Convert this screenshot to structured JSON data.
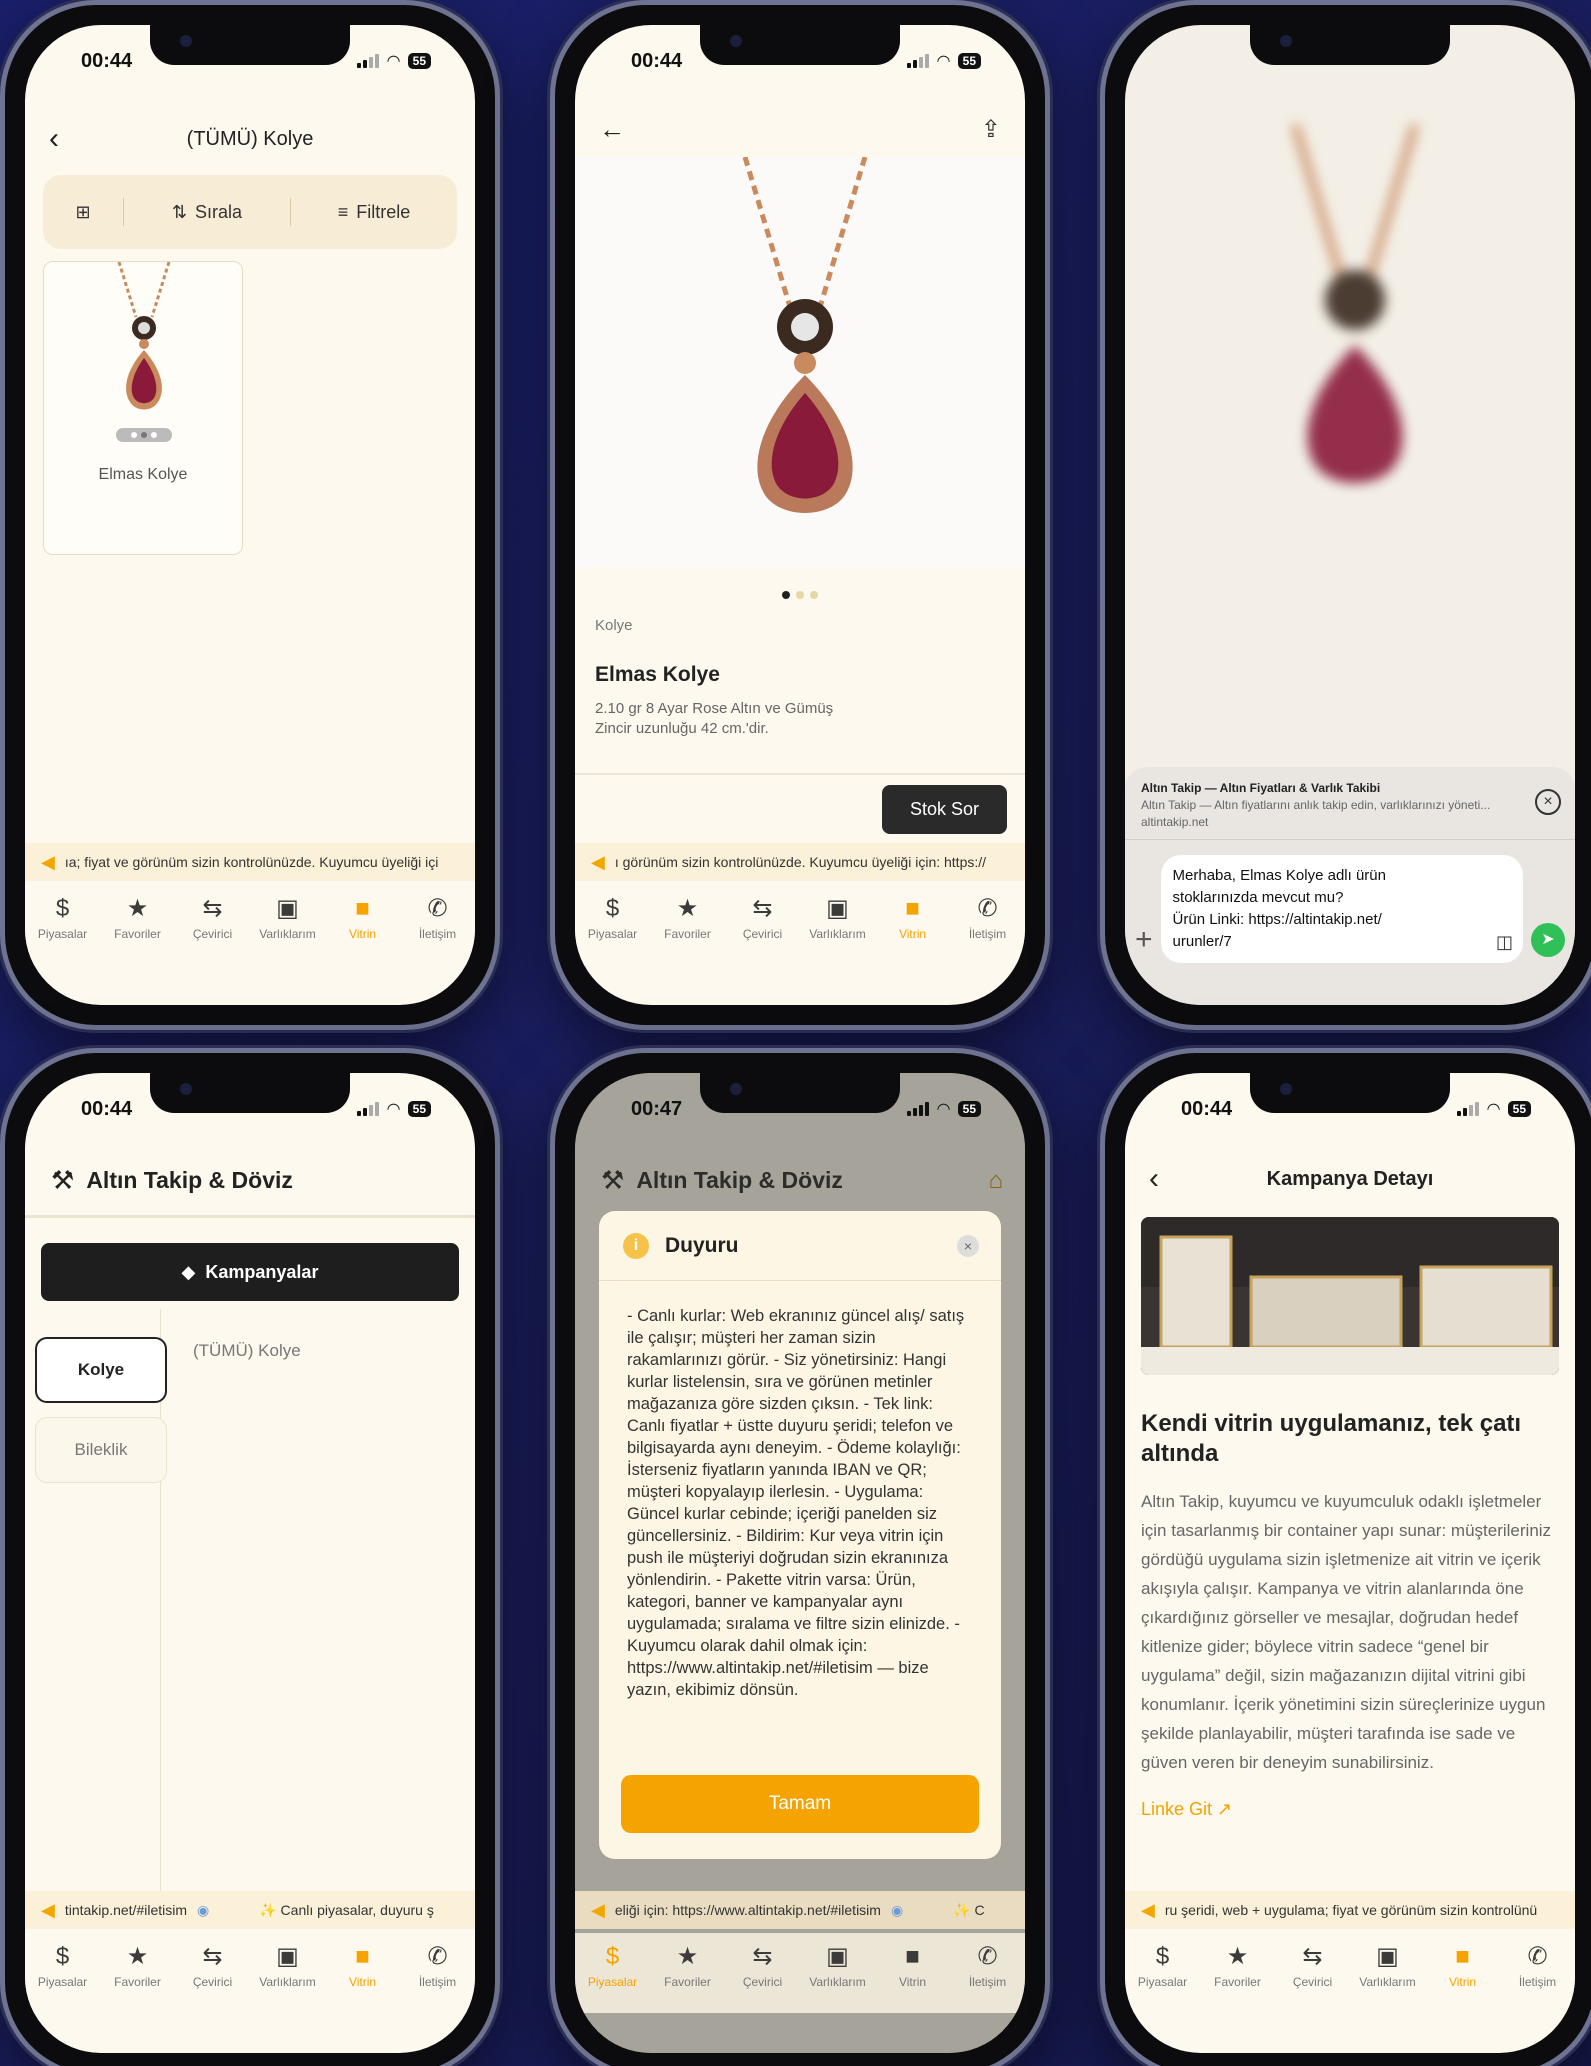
{
  "status": {
    "time_standard": "00:44",
    "time_dialog": "00:47",
    "battery": "55"
  },
  "tabs": [
    {
      "label": "Piyasalar",
      "icon": "dollar-circle-icon",
      "glyph": "$"
    },
    {
      "label": "Favoriler",
      "icon": "star-icon",
      "glyph": "★"
    },
    {
      "label": "Çevirici",
      "icon": "swap-icon",
      "glyph": "⇆"
    },
    {
      "label": "Varlıklarım",
      "icon": "box-icon",
      "glyph": "▣"
    },
    {
      "label": "Vitrin",
      "icon": "shopping-bag-icon",
      "glyph": "■"
    },
    {
      "label": "İletişim",
      "icon": "phone-icon",
      "glyph": "✆"
    }
  ],
  "phone1": {
    "title": "(TÜMÜ) Kolye",
    "sort_label": "Sırala",
    "filter_label": "Filtrele",
    "product_name": "Elmas Kolye",
    "ticker": "ıa; fiyat ve görünüm sizin kontrolünüzde. Kuyumcu üyeliği içi"
  },
  "phone2": {
    "category": "Kolye",
    "product_name": "Elmas Kolye",
    "description_line1": "2.10 gr 8 Ayar Rose Altın ve Gümüş",
    "description_line2": "Zincir uzunluğu 42 cm.'dir.",
    "stock_button": "Stok Sor",
    "ticker": "ı görünüm sizin kontrolünüzde. Kuyumcu üyeliği için: https://"
  },
  "phone3": {
    "share_title": "Altın Takip — Altın Fiyatları & Varlık Takibi",
    "share_subtitle": "Altın Takip — Altın fiyatlarını anlık takip edin, varlıklarınızı yöneti...",
    "share_url": "altintakip.net",
    "message_line1": "Merhaba, Elmas Kolye adlı ürün",
    "message_line2": "stoklarınızda mevcut mu?",
    "message_line3": "Ürün Linki: https://altintakip.net/",
    "message_line4": "urunler/7"
  },
  "phone4": {
    "app_title": "Altın Takip & Döviz",
    "campaigns_button": "Kampanyalar",
    "category_selected": "Kolye",
    "category_other": "Bileklik",
    "subcategory": "(TÜMÜ) Kolye",
    "ticker_left": "tintakip.net/#iletisim",
    "ticker_right": "✨ Canlı piyasalar, duyuru ş"
  },
  "phone5": {
    "app_title": "Altın Takip & Döviz",
    "dialog_title": "Duyuru",
    "dialog_body": "- Canlı kurlar: Web ekranınız güncel alış/ satış ile çalışır; müşteri her zaman sizin rakamlarınızı görür. - Siz yönetirsiniz: Hangi kurlar listelensin, sıra ve görünen metinler mağazanıza göre sizden çıksın. - Tek link: Canlı fiyatlar + üstte duyuru şeridi; telefon ve bilgisayarda aynı deneyim. - Ödeme kolaylığı: İsterseniz fiyatların yanında IBAN ve QR; müşteri kopyalayıp ilerlesin. - Uygulama: Güncel kurlar cebinde; içeriği panelden siz güncellersiniz. - Bildirim: Kur veya vitrin için push ile müşteriyi doğrudan sizin ekranınıza yönlendirin. - Pakette vitrin varsa: Ürün, kategori, banner ve kampanyalar aynı uygulamada; sıralama ve filtre sizin elinizde. - Kuyumcu olarak dahil olmak için: https://www.altintakip.net/#iletisim — bize yazın, ekibimiz dönsün.",
    "ok_button": "Tamam",
    "ticker_left": "eliği için: https://www.altintakip.net/#iletisim",
    "ticker_right": "✨ C"
  },
  "phone6": {
    "title": "Kampanya Detayı",
    "heading": "Kendi vitrin uygulamanız, tek çatı altında",
    "paragraph": "Altın Takip, kuyumcu ve kuyumculuk odaklı işletmeler için tasarlanmış bir container yapı sunar: müşterileriniz gördüğü uygulama sizin işletmenize ait vitrin ve içerik akışıyla çalışır. Kampanya ve vitrin alanlarında öne çıkardığınız görseller ve mesajlar, doğrudan hedef kitlenize gider; böylece vitrin sadece “genel bir uygulama” değil, sizin mağazanızın dijital vitrini gibi konumlanır. İçerik yönetimini sizin süreçlerinize uygun şekilde planlayabilir, müşteri tarafında ise sade ve güven veren bir deneyim sunabilirsiniz.",
    "link_label": "Linke Git ↗",
    "ticker": "ru şeridi, web + uygulama; fiyat ve görünüm sizin kontrolünü"
  },
  "colors": {
    "accent": "#f5a300",
    "background": "#fdf9ee",
    "page_bg": "#1b1e5e"
  }
}
